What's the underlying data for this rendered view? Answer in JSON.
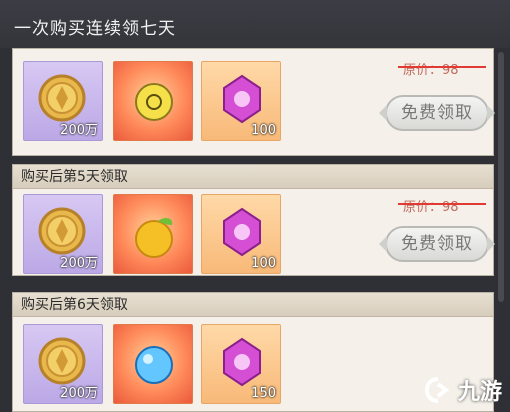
{
  "title": "一次购买连续领七天",
  "cards": [
    {
      "header": "",
      "items": [
        {
          "icon": "gold-coin-icon",
          "qty": "200万"
        },
        {
          "icon": "yellow-orb-icon",
          "qty": ""
        },
        {
          "icon": "purple-gem-icon",
          "qty": "100"
        }
      ],
      "price": "原价：98",
      "button": "免费领取"
    },
    {
      "header": "购买后第5天领取",
      "items": [
        {
          "icon": "gold-coin-icon",
          "qty": "200万"
        },
        {
          "icon": "golden-fruit-icon",
          "qty": ""
        },
        {
          "icon": "purple-gem-icon",
          "qty": "100"
        }
      ],
      "price": "原价：98",
      "button": "免费领取"
    },
    {
      "header": "购买后第6天领取",
      "items": [
        {
          "icon": "gold-coin-icon",
          "qty": "200万"
        },
        {
          "icon": "blue-orb-icon",
          "qty": ""
        },
        {
          "icon": "purple-gem-icon",
          "qty": "150"
        }
      ]
    }
  ],
  "watermark": "九游"
}
